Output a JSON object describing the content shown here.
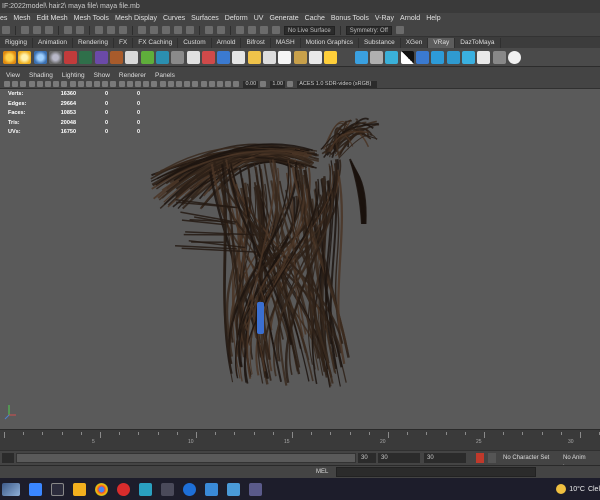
{
  "window": {
    "title": "IF:2022model\\ hair2\\ maya file\\ maya file.mb"
  },
  "menu": [
    "es",
    "Mesh",
    "Edit Mesh",
    "Mesh Tools",
    "Mesh Display",
    "Curves",
    "Surfaces",
    "Deform",
    "UV",
    "Generate",
    "Cache",
    "Bonus Tools",
    "V-Ray",
    "Arnold",
    "Help"
  ],
  "status_line": {
    "live_surface": "No Live Surface",
    "symmetry": "Symmetry: Off"
  },
  "shelf_tabs": [
    {
      "label": "Rigging",
      "active": false
    },
    {
      "label": "Animation",
      "active": false
    },
    {
      "label": "Rendering",
      "active": false
    },
    {
      "label": "FX",
      "active": false
    },
    {
      "label": "FX Caching",
      "active": false
    },
    {
      "label": "Custom",
      "active": false
    },
    {
      "label": "Arnold",
      "active": false
    },
    {
      "label": "Bifrost",
      "active": false
    },
    {
      "label": "MASH",
      "active": false
    },
    {
      "label": "Motion Graphics",
      "active": false
    },
    {
      "label": "Substance",
      "active": false
    },
    {
      "label": "XGen",
      "active": false
    },
    {
      "label": "VRay",
      "active": true
    },
    {
      "label": "DazToMaya",
      "active": false
    }
  ],
  "panel_menu": [
    "View",
    "Shading",
    "Lighting",
    "Show",
    "Renderer",
    "Panels"
  ],
  "panel_toolbar": {
    "value_a": "0.00",
    "value_b": "1.00",
    "color_space": "ACES 1.0 SDR-video (sRGB)"
  },
  "hud": [
    {
      "label": "Verts:",
      "v1": "16360",
      "v2": "0",
      "v3": "0"
    },
    {
      "label": "Edges:",
      "v1": "29664",
      "v2": "0",
      "v3": "0"
    },
    {
      "label": "Faces:",
      "v1": "10853",
      "v2": "0",
      "v3": "0"
    },
    {
      "label": "Tris:",
      "v1": "20048",
      "v2": "0",
      "v3": "0"
    },
    {
      "label": "UVs:",
      "v1": "16750",
      "v2": "0",
      "v3": "0"
    }
  ],
  "timeline": {
    "ticks": [
      "5",
      "10",
      "15",
      "20",
      "25",
      "30"
    ]
  },
  "range": {
    "current_end": "30",
    "start": "30",
    "end": "30",
    "character_set": "No Character Set",
    "anim_layer": "No Anim Layer"
  },
  "command_line": {
    "label": "MEL"
  },
  "tray": {
    "temperature": "10°C",
    "weather": "Clel"
  },
  "colors": {
    "viewport_bg": "#5a5a5a",
    "ui_bg": "#444444",
    "taskbar_bg": "#1d1d2b",
    "hair_band": "#3b6fd0"
  }
}
